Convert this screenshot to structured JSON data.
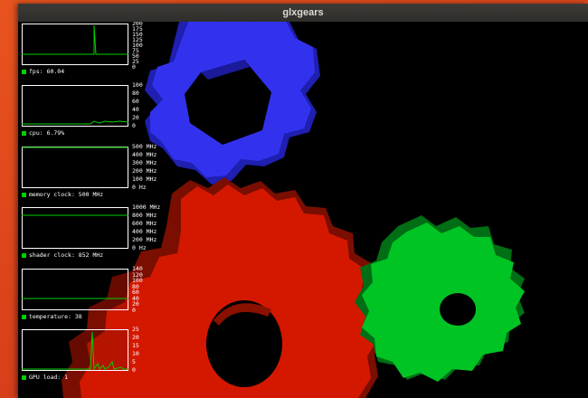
{
  "window": {
    "title": "glxgears"
  },
  "hud": {
    "graphs": [
      {
        "caption": "fps: 60.04",
        "ticks": [
          "200",
          "175",
          "150",
          "125",
          "100",
          "75",
          "50",
          "25",
          "0"
        ]
      },
      {
        "caption": "cpu: 6.79%",
        "ticks": [
          "100",
          "80",
          "60",
          "40",
          "20",
          "0"
        ]
      },
      {
        "caption": "memory clock: 500 MHz",
        "ticks": [
          "500 MHz",
          "400 MHz",
          "300 MHz",
          "200 MHz",
          "100 MHz",
          "0 Hz"
        ]
      },
      {
        "caption": "shader clock: 852 MHz",
        "ticks": [
          "1000 MHz",
          "800 MHz",
          "600 MHz",
          "400 MHz",
          "200 MHz",
          "0 Hz"
        ]
      },
      {
        "caption": "temperature: 38",
        "ticks": [
          "140",
          "120",
          "100",
          "80",
          "60",
          "40",
          "20",
          "0"
        ]
      },
      {
        "caption": "GPU load: 1",
        "ticks": [
          "25",
          "20",
          "15",
          "10",
          "5",
          "0"
        ]
      }
    ]
  },
  "colors": {
    "gear_blue": "#2f2fe6",
    "gear_red": "#d41800",
    "gear_green": "#00c424",
    "hud_line": "#00d000"
  }
}
